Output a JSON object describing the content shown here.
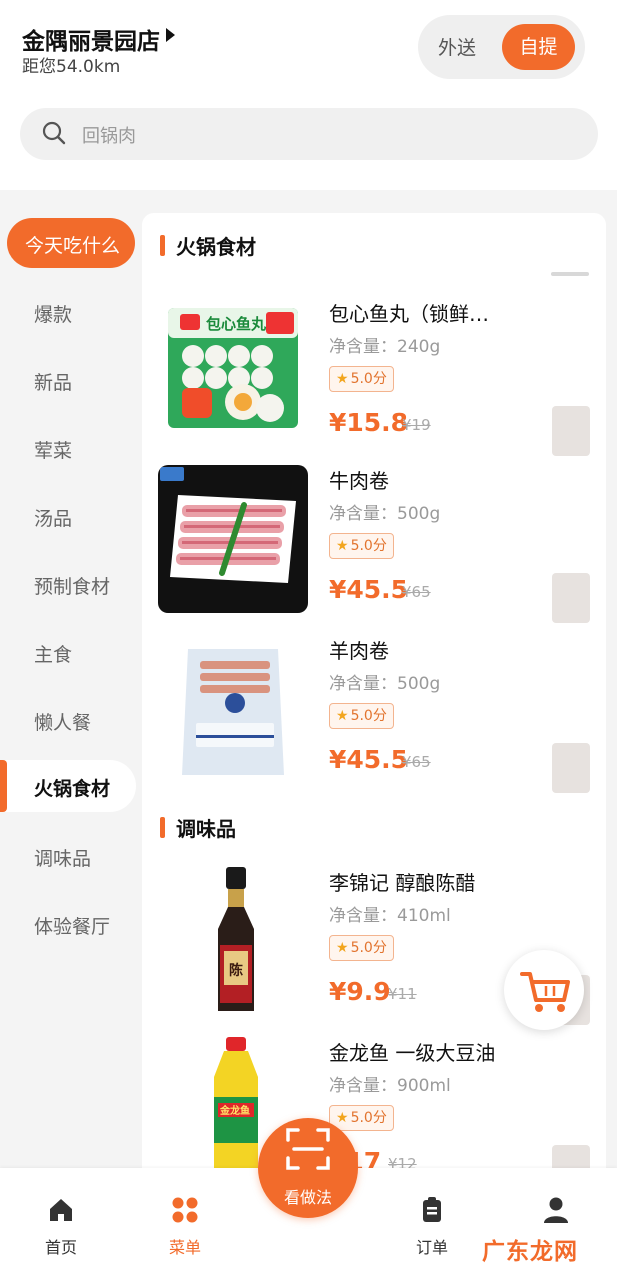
{
  "header": {
    "store_name": "金隅丽景园店",
    "distance": "距您54.0km",
    "mode_delivery": "外送",
    "mode_pickup": "自提"
  },
  "search": {
    "placeholder": "回锅肉"
  },
  "sidebar": {
    "items": [
      {
        "label": "今天吃什么",
        "state": "promo"
      },
      {
        "label": "爆款"
      },
      {
        "label": "新品"
      },
      {
        "label": "荤菜"
      },
      {
        "label": "汤品"
      },
      {
        "label": "预制食材"
      },
      {
        "label": "主食"
      },
      {
        "label": "懒人餐"
      },
      {
        "label": "火锅食材",
        "state": "active"
      },
      {
        "label": "调味品"
      },
      {
        "label": "体验餐厅"
      }
    ]
  },
  "sections": [
    {
      "title": "火锅食材"
    },
    {
      "title": "调味品"
    }
  ],
  "products": [
    {
      "name": "包心鱼丸（锁鲜…",
      "net": "净含量：240g",
      "rating": "5.0分",
      "price": "¥15.8",
      "orig": "¥19",
      "image": "fish-ball-package"
    },
    {
      "name": "牛肉卷",
      "net": "净含量：500g",
      "rating": "5.0分",
      "price": "¥45.5",
      "orig": "¥65",
      "image": "beef-roll-plate"
    },
    {
      "name": "羊肉卷",
      "net": "净含量：500g",
      "rating": "5.0分",
      "price": "¥45.5",
      "orig": "¥65",
      "image": "lamb-roll-bag"
    },
    {
      "name": "李锦记 醇酿陈醋",
      "net": "净含量：410ml",
      "rating": "5.0分",
      "price": "¥9.9",
      "orig": "¥11",
      "image": "vinegar-bottle"
    },
    {
      "name": "金龙鱼 一级大豆油",
      "net": "净含量：900ml",
      "rating": "5.0分",
      "price": "¥17",
      "orig": "¥12",
      "image": "soybean-oil-bottle"
    }
  ],
  "nav": {
    "home": "首页",
    "menu": "菜单",
    "scan": "看做法",
    "orders": "订单",
    "profile": ""
  },
  "watermark": "广东龙网",
  "colors": {
    "accent": "#f26b2b",
    "star": "#f2a51e"
  }
}
